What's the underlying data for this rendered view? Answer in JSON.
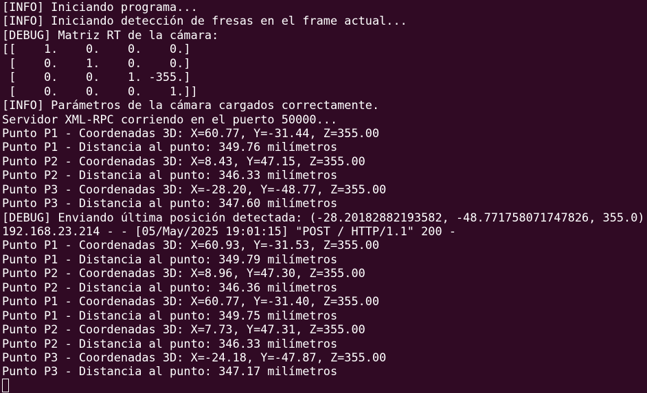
{
  "terminal": {
    "lines": [
      "[INFO] Iniciando programa...",
      "[INFO] Iniciando detección de fresas en el frame actual...",
      "[DEBUG] Matriz RT de la cámara:",
      "[[    1.    0.    0.    0.]",
      " [    0.    1.    0.    0.]",
      " [    0.    0.    1. -355.]",
      " [    0.    0.    0.    1.]]",
      "[INFO] Parámetros de la cámara cargados correctamente.",
      "Servidor XML-RPC corriendo en el puerto 50000...",
      "Punto P1 - Coordenadas 3D: X=60.77, Y=-31.44, Z=355.00",
      "Punto P1 - Distancia al punto: 349.76 milímetros",
      "Punto P2 - Coordenadas 3D: X=8.43, Y=47.15, Z=355.00",
      "Punto P2 - Distancia al punto: 346.33 milímetros",
      "Punto P3 - Coordenadas 3D: X=-28.20, Y=-48.77, Z=355.00",
      "Punto P3 - Distancia al punto: 347.60 milímetros",
      "[DEBUG] Enviando última posición detectada: (-28.20182882193582, -48.771758071747826, 355.0)",
      "192.168.23.214 - - [05/May/2025 19:01:15] \"POST / HTTP/1.1\" 200 -",
      "Punto P1 - Coordenadas 3D: X=60.93, Y=-31.53, Z=355.00",
      "Punto P1 - Distancia al punto: 349.79 milímetros",
      "Punto P2 - Coordenadas 3D: X=8.96, Y=47.30, Z=355.00",
      "Punto P2 - Distancia al punto: 346.36 milímetros",
      "Punto P1 - Coordenadas 3D: X=60.77, Y=-31.40, Z=355.00",
      "Punto P1 - Distancia al punto: 349.75 milímetros",
      "Punto P2 - Coordenadas 3D: X=7.73, Y=47.31, Z=355.00",
      "Punto P2 - Distancia al punto: 346.33 milímetros",
      "Punto P3 - Coordenadas 3D: X=-24.18, Y=-47.87, Z=355.00",
      "Punto P3 - Distancia al punto: 347.17 milímetros"
    ]
  },
  "colors": {
    "background": "#300a24",
    "foreground": "#ffffff"
  },
  "icons": {
    "cursor": "block-cursor-icon"
  }
}
